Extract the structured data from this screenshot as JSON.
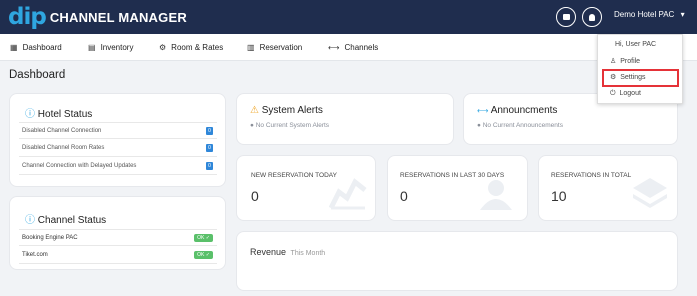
{
  "app": {
    "logo_mark": "dip",
    "logo_text": "CHANNEL MANAGER"
  },
  "topbar": {
    "message_icon": "message-icon",
    "bell_icon": "bell-icon",
    "user_menu_label": "Demo Hotel PAC",
    "caret": "▾"
  },
  "nav": {
    "items": [
      {
        "icon": "▦",
        "label": "Dashboard"
      },
      {
        "icon": "▤",
        "label": "Inventory"
      },
      {
        "icon": "⚙",
        "label": "Room & Rates"
      },
      {
        "icon": "▥",
        "label": "Reservation"
      },
      {
        "icon": "⟷",
        "label": "Channels"
      }
    ]
  },
  "page": {
    "title": "Dashboard"
  },
  "hotel_status": {
    "title": "Hotel Status",
    "rows": [
      {
        "label": "Disabled Channel Connection",
        "count": "0"
      },
      {
        "label": "Disabled Channel Room Rates",
        "count": "0"
      },
      {
        "label": "Channel Connection with Delayed Updates",
        "count": "0"
      }
    ]
  },
  "channel_status": {
    "title": "Channel Status",
    "rows": [
      {
        "label": "Booking Engine PAC",
        "status": "OK ✓"
      },
      {
        "label": "Tiket.com",
        "status": "OK ✓"
      }
    ]
  },
  "system_alerts": {
    "icon": "⚠",
    "title": "System Alerts",
    "message": "● No Current System Alerts"
  },
  "announcements": {
    "icon": "⟷",
    "title": "Announcments",
    "message": "● No Current Announcements"
  },
  "stats": [
    {
      "label": "NEW RESERVATION TODAY",
      "value": "0"
    },
    {
      "label": "RESERVATIONS IN LAST 30 DAYS",
      "value": "0"
    },
    {
      "label": "RESERVATIONS IN TOTAL",
      "value": "10"
    }
  ],
  "revenue": {
    "title": "Revenue",
    "subtitle": "This Month"
  },
  "dropdown": {
    "greeting": "Hi, User PAC",
    "items": [
      {
        "icon": "♙",
        "label": "Profile"
      },
      {
        "icon": "⚙",
        "label": "Settings"
      },
      {
        "icon": "⏻",
        "label": "Logout"
      }
    ]
  },
  "colors": {
    "topbar": "#1f2d4e",
    "accent": "#2fa6e0",
    "highlight": "#e53238",
    "ok": "#5ac06a",
    "badge": "#2f87d9"
  }
}
